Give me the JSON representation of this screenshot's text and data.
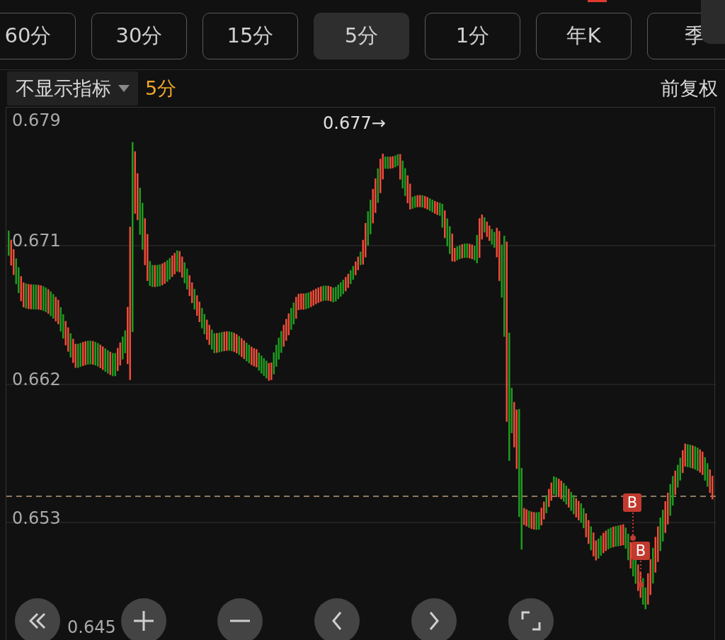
{
  "tabs": [
    {
      "label": "60分",
      "selected": false
    },
    {
      "label": "30分",
      "selected": false
    },
    {
      "label": "15分",
      "selected": false
    },
    {
      "label": "5分",
      "selected": true
    },
    {
      "label": "1分",
      "selected": false
    },
    {
      "label": "年K",
      "selected": false
    },
    {
      "label": "季",
      "selected": false
    }
  ],
  "indicator_dropdown": {
    "value": "不显示指标"
  },
  "period_label": "5分",
  "adjustment": "前复权",
  "chart": {
    "kind": "picture",
    "price_labels": [
      "0.679",
      "0.671",
      "0.662",
      "0.653",
      "0.645"
    ],
    "high_marker": "0.677→",
    "trade_markers": [
      "B",
      "B"
    ]
  }
}
